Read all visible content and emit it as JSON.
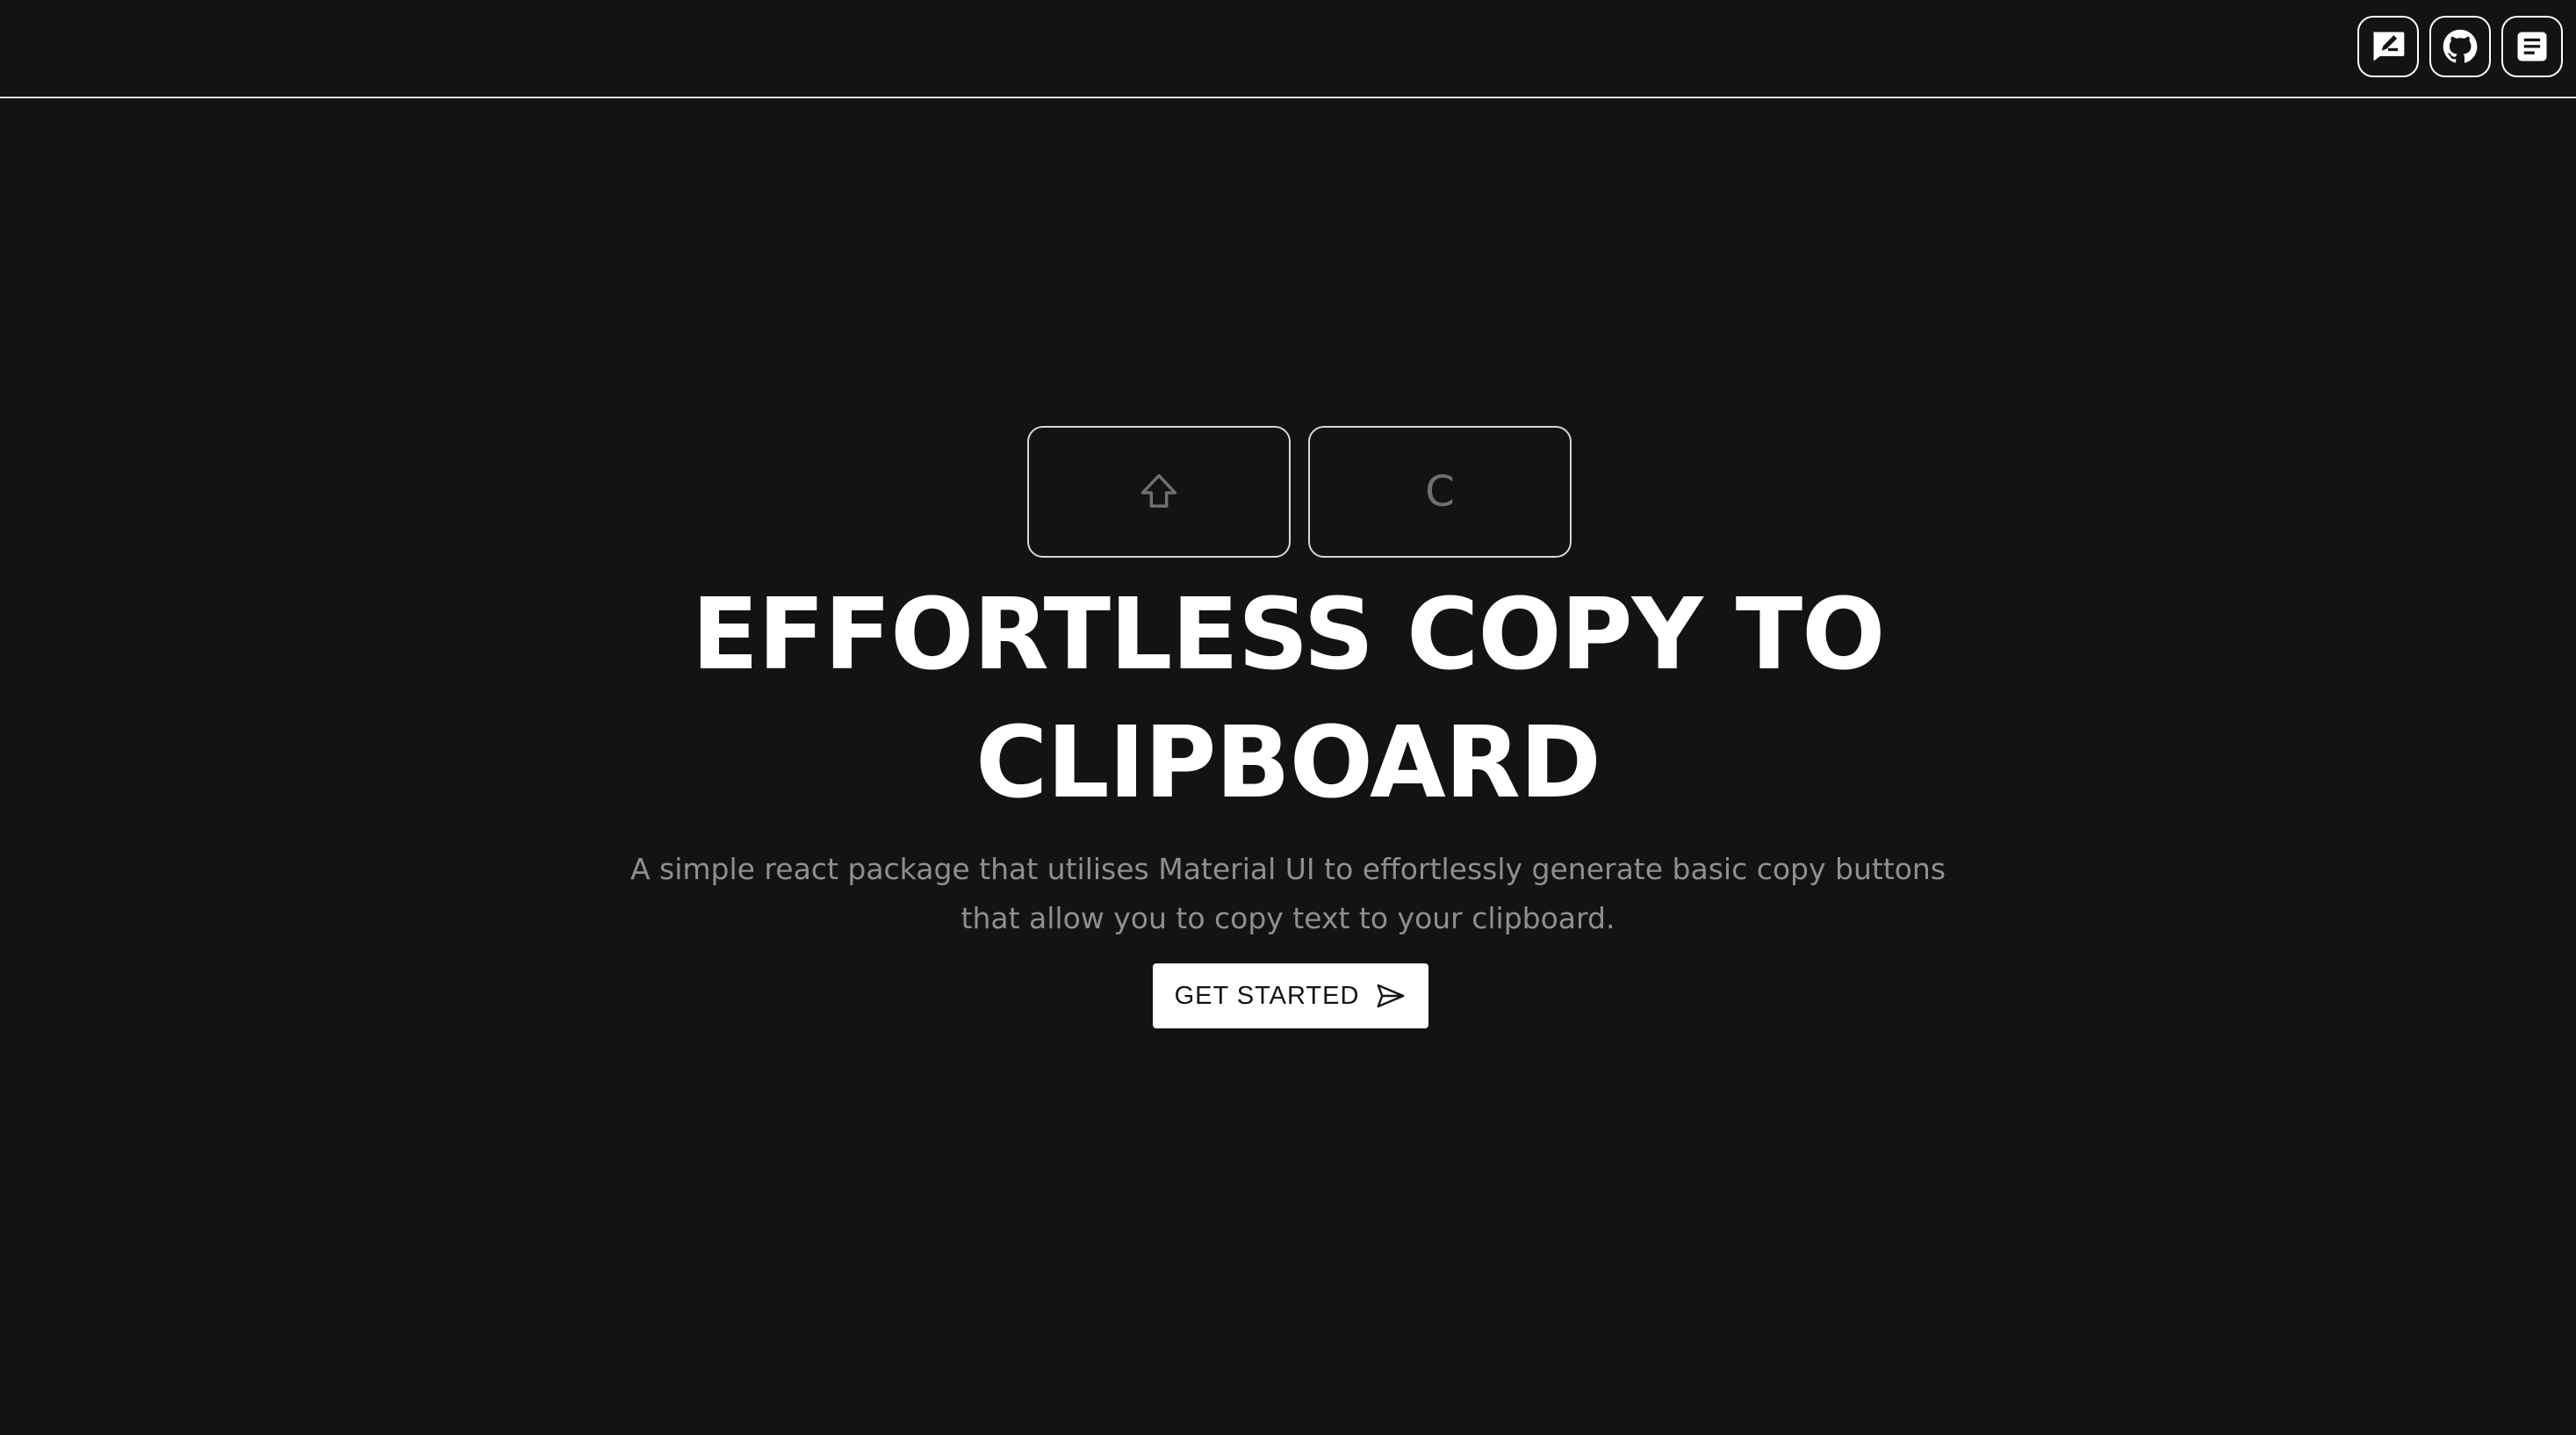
{
  "header": {
    "icons": [
      {
        "name": "feedback-icon"
      },
      {
        "name": "github-icon"
      },
      {
        "name": "docs-icon"
      }
    ]
  },
  "hero": {
    "keys": [
      {
        "icon": "shift-arrow-icon",
        "label": ""
      },
      {
        "icon": "",
        "label": "C"
      }
    ],
    "title_line1": "EFFORTLESS COPY TO",
    "title_line2": "CLIPBOARD",
    "subtitle_line1": "A simple react package that utilises Material UI to effortlessly generate basic copy buttons",
    "subtitle_line2": "that allow you to copy text to your clipboard.",
    "cta_label": "GET STARTED",
    "cta_icon": "send-icon"
  },
  "colors": {
    "background": "#131313",
    "foreground": "#ffffff",
    "muted_text": "#8f8f8f",
    "key_glyph": "#6f6f6f"
  }
}
